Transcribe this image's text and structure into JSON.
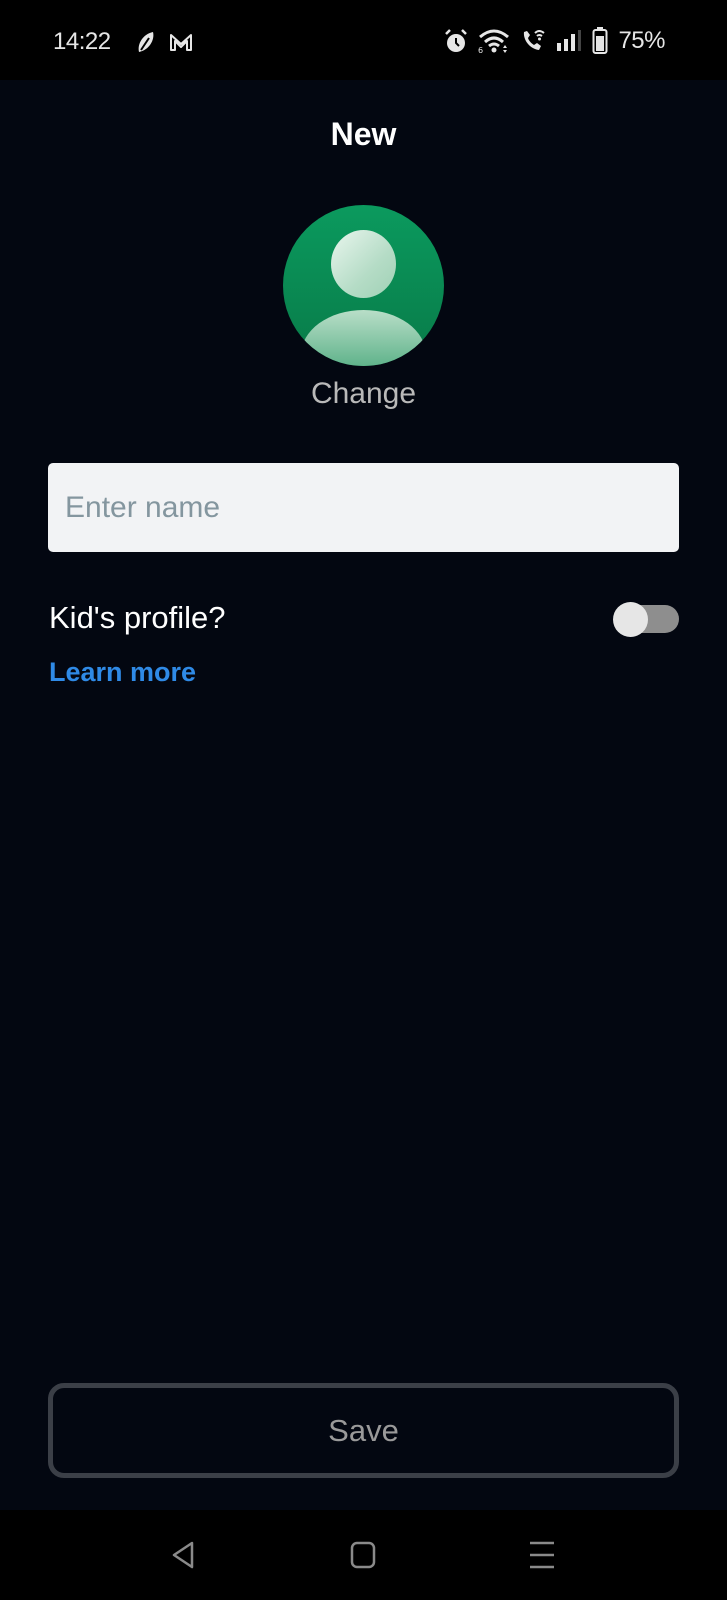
{
  "status_bar": {
    "time": "14:22",
    "left_icons": [
      "leaf-notification-icon",
      "gmail-icon"
    ],
    "right_icons": [
      "alarm-icon",
      "wifi-icon",
      "wifi-calling-icon",
      "signal-icon",
      "battery-icon"
    ],
    "battery_percent": "75%"
  },
  "screen": {
    "title": "New",
    "avatar": {
      "icon": "default-profile-avatar",
      "color": "#0b8f57"
    },
    "change_label": "Change",
    "name_input": {
      "value": "",
      "placeholder": "Enter name"
    },
    "kids_profile": {
      "label": "Kid's profile?",
      "enabled": false
    },
    "learn_more_label": "Learn more",
    "save_label": "Save"
  },
  "nav_bar": {
    "buttons": [
      "back",
      "home",
      "recents"
    ]
  },
  "colors": {
    "background": "#030711",
    "link": "#2f8ae6",
    "avatar_green": "#0b8f57"
  }
}
